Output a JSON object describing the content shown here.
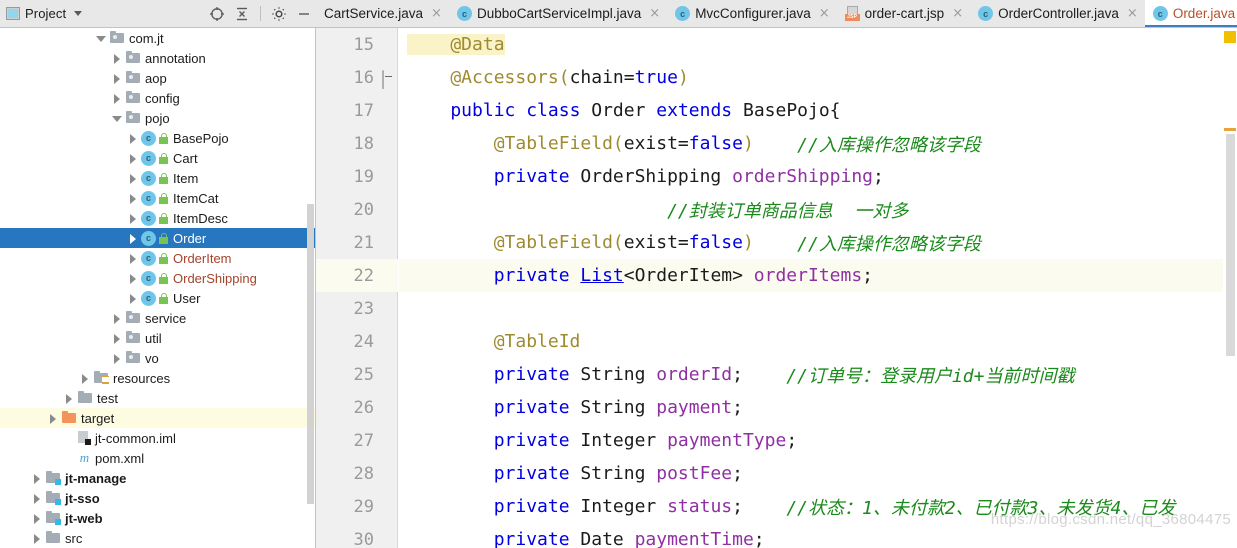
{
  "project_panel": {
    "title": "Project",
    "icon": "project-window-icon",
    "dropdown_icon": "chevron-down-icon",
    "toolbar": [
      {
        "name": "locate-target-icon",
        "label": "Select Opened File"
      },
      {
        "name": "collapse-all-icon",
        "label": "Collapse All"
      },
      {
        "name": "gear-icon",
        "label": "Settings"
      },
      {
        "name": "minimize-icon",
        "label": "Hide"
      }
    ]
  },
  "tabs": {
    "overflow_icon": "chevron-down-icon",
    "items": [
      {
        "label": "CartService.java",
        "icon": "java-class-icon",
        "active": false,
        "closable": true
      },
      {
        "label": "DubboCartServiceImpl.java",
        "icon": "java-class-icon",
        "active": false,
        "closable": true
      },
      {
        "label": "MvcConfigurer.java",
        "icon": "java-class-icon",
        "active": false,
        "closable": true
      },
      {
        "label": "order-cart.jsp",
        "icon": "jsp-file-icon",
        "active": false,
        "closable": true
      },
      {
        "label": "OrderController.java",
        "icon": "java-class-icon",
        "active": false,
        "closable": true
      },
      {
        "label": "Order.java",
        "icon": "java-class-icon",
        "active": true,
        "closable": true
      }
    ]
  },
  "tree": {
    "items": [
      {
        "label": "com.jt",
        "indent": 6,
        "arrow": "down",
        "icon": "package-folder-icon",
        "state": "normal"
      },
      {
        "label": "annotation",
        "indent": 7,
        "arrow": "right",
        "icon": "package-folder-icon",
        "state": "normal"
      },
      {
        "label": "aop",
        "indent": 7,
        "arrow": "right",
        "icon": "package-folder-icon",
        "state": "normal"
      },
      {
        "label": "config",
        "indent": 7,
        "arrow": "right",
        "icon": "package-folder-icon",
        "state": "normal"
      },
      {
        "label": "pojo",
        "indent": 7,
        "arrow": "down",
        "icon": "package-folder-icon",
        "state": "normal"
      },
      {
        "label": "BasePojo",
        "indent": 8,
        "arrow": "right",
        "icon": "java-class-icon",
        "state": "normal"
      },
      {
        "label": "Cart",
        "indent": 8,
        "arrow": "right",
        "icon": "java-class-icon",
        "state": "normal"
      },
      {
        "label": "Item",
        "indent": 8,
        "arrow": "right",
        "icon": "java-class-icon",
        "state": "normal"
      },
      {
        "label": "ItemCat",
        "indent": 8,
        "arrow": "right",
        "icon": "java-class-icon",
        "state": "normal"
      },
      {
        "label": "ItemDesc",
        "indent": 8,
        "arrow": "right",
        "icon": "java-class-icon",
        "state": "normal"
      },
      {
        "label": "Order",
        "indent": 8,
        "arrow": "right",
        "icon": "java-class-icon",
        "state": "selected"
      },
      {
        "label": "OrderItem",
        "indent": 8,
        "arrow": "right",
        "icon": "java-class-icon",
        "state": "modified"
      },
      {
        "label": "OrderShipping",
        "indent": 8,
        "arrow": "right",
        "icon": "java-class-icon",
        "state": "modified"
      },
      {
        "label": "User",
        "indent": 8,
        "arrow": "right",
        "icon": "java-class-icon",
        "state": "normal"
      },
      {
        "label": "service",
        "indent": 7,
        "arrow": "right",
        "icon": "package-folder-icon",
        "state": "normal"
      },
      {
        "label": "util",
        "indent": 7,
        "arrow": "right",
        "icon": "package-folder-icon",
        "state": "normal"
      },
      {
        "label": "vo",
        "indent": 7,
        "arrow": "right",
        "icon": "package-folder-icon",
        "state": "normal"
      },
      {
        "label": "resources",
        "indent": 5,
        "arrow": "right",
        "icon": "resources-folder-icon",
        "state": "normal"
      },
      {
        "label": "test",
        "indent": 4,
        "arrow": "right",
        "icon": "folder-icon",
        "state": "normal"
      },
      {
        "label": "target",
        "indent": 3,
        "arrow": "right",
        "icon": "excluded-folder-icon",
        "state": "highlighted"
      },
      {
        "label": "jt-common.iml",
        "indent": 4,
        "arrow": "none",
        "icon": "iml-file-icon",
        "state": "normal"
      },
      {
        "label": "pom.xml",
        "indent": 4,
        "arrow": "none",
        "icon": "maven-file-icon",
        "state": "normal"
      },
      {
        "label": "jt-manage",
        "indent": 2,
        "arrow": "right",
        "icon": "module-folder-icon",
        "state": "module"
      },
      {
        "label": "jt-sso",
        "indent": 2,
        "arrow": "right",
        "icon": "module-folder-icon",
        "state": "module"
      },
      {
        "label": "jt-web",
        "indent": 2,
        "arrow": "right",
        "icon": "module-folder-icon",
        "state": "module"
      },
      {
        "label": "src",
        "indent": 2,
        "arrow": "right",
        "icon": "folder-icon",
        "state": "normal"
      }
    ]
  },
  "editor": {
    "file": "Order.java",
    "current_line": 22,
    "lines": [
      {
        "num": "15",
        "fold": "none",
        "tokens": [
          {
            "t": "@Data",
            "c": "ann hl-data",
            "indent": 4
          }
        ]
      },
      {
        "num": "16",
        "fold": "top",
        "tokens": [
          {
            "t": "@Accessors(",
            "c": "ann",
            "indent": 4
          },
          {
            "t": "chain=",
            "c": "plain"
          },
          {
            "t": "true",
            "c": "kw"
          },
          {
            "t": ")",
            "c": "ann"
          }
        ]
      },
      {
        "num": "17",
        "fold": "none",
        "tokens": [
          {
            "t": "public ",
            "c": "kw",
            "indent": 4
          },
          {
            "t": "class ",
            "c": "kw"
          },
          {
            "t": "Order ",
            "c": "plain"
          },
          {
            "t": "extends ",
            "c": "kw"
          },
          {
            "t": "BasePojo{",
            "c": "plain"
          }
        ]
      },
      {
        "num": "18",
        "fold": "none",
        "tokens": [
          {
            "t": "@TableField(",
            "c": "ann",
            "indent": 8
          },
          {
            "t": "exist=",
            "c": "plain"
          },
          {
            "t": "false",
            "c": "kw"
          },
          {
            "t": ")",
            "c": "ann"
          },
          {
            "t": "    //入库操作忽略该字段",
            "c": "cmt"
          }
        ]
      },
      {
        "num": "19",
        "fold": "none",
        "tokens": [
          {
            "t": "private ",
            "c": "kw",
            "indent": 8
          },
          {
            "t": "OrderShipping ",
            "c": "plain"
          },
          {
            "t": "orderShipping",
            "c": "fld"
          },
          {
            "t": ";",
            "c": "plain"
          }
        ]
      },
      {
        "num": "20",
        "fold": "none",
        "tokens": [
          {
            "t": "//封装订单商品信息  一对多",
            "c": "cmt",
            "indent": 24
          }
        ]
      },
      {
        "num": "21",
        "fold": "none",
        "tokens": [
          {
            "t": "@TableField(",
            "c": "ann",
            "indent": 8
          },
          {
            "t": "exist=",
            "c": "plain"
          },
          {
            "t": "false",
            "c": "kw"
          },
          {
            "t": ")",
            "c": "ann"
          },
          {
            "t": "    //入库操作忽略该字段",
            "c": "cmt"
          }
        ]
      },
      {
        "num": "22",
        "fold": "none",
        "current": true,
        "tokens": [
          {
            "t": "private ",
            "c": "kw",
            "indent": 8
          },
          {
            "t": "List",
            "c": "lnk"
          },
          {
            "t": "<OrderItem> ",
            "c": "plain"
          },
          {
            "t": "orderItems",
            "c": "fld"
          },
          {
            "t": ";",
            "c": "plain"
          }
        ]
      },
      {
        "num": "23",
        "fold": "none",
        "tokens": []
      },
      {
        "num": "24",
        "fold": "none",
        "tokens": [
          {
            "t": "@TableId",
            "c": "ann",
            "indent": 8
          }
        ]
      },
      {
        "num": "25",
        "fold": "none",
        "tokens": [
          {
            "t": "private ",
            "c": "kw",
            "indent": 8
          },
          {
            "t": "String ",
            "c": "plain"
          },
          {
            "t": "orderId",
            "c": "fld"
          },
          {
            "t": ";",
            "c": "plain"
          },
          {
            "t": "    //订单号：登录用户id+当前时间戳",
            "c": "cmt"
          }
        ]
      },
      {
        "num": "26",
        "fold": "none",
        "tokens": [
          {
            "t": "private ",
            "c": "kw",
            "indent": 8
          },
          {
            "t": "String ",
            "c": "plain"
          },
          {
            "t": "payment",
            "c": "fld"
          },
          {
            "t": ";",
            "c": "plain"
          }
        ]
      },
      {
        "num": "27",
        "fold": "none",
        "tokens": [
          {
            "t": "private ",
            "c": "kw",
            "indent": 8
          },
          {
            "t": "Integer ",
            "c": "plain"
          },
          {
            "t": "paymentType",
            "c": "fld"
          },
          {
            "t": ";",
            "c": "plain"
          }
        ]
      },
      {
        "num": "28",
        "fold": "none",
        "tokens": [
          {
            "t": "private ",
            "c": "kw",
            "indent": 8
          },
          {
            "t": "String ",
            "c": "plain"
          },
          {
            "t": "postFee",
            "c": "fld"
          },
          {
            "t": ";",
            "c": "plain"
          }
        ]
      },
      {
        "num": "29",
        "fold": "none",
        "tokens": [
          {
            "t": "private ",
            "c": "kw",
            "indent": 8
          },
          {
            "t": "Integer ",
            "c": "plain"
          },
          {
            "t": "status",
            "c": "fld"
          },
          {
            "t": ";",
            "c": "plain"
          },
          {
            "t": "    //状态：1、未付款2、已付款3、未发货4、已发",
            "c": "cmt"
          }
        ]
      },
      {
        "num": "30",
        "fold": "none",
        "tokens": [
          {
            "t": "private ",
            "c": "kw",
            "indent": 8
          },
          {
            "t": "Date ",
            "c": "plain"
          },
          {
            "t": "paymentTime",
            "c": "fld"
          },
          {
            "t": ";",
            "c": "plain"
          }
        ]
      }
    ]
  },
  "watermark": "https://blog.csdn.net/qq_36804475",
  "colors": {
    "selection_blue": "#2677c0",
    "active_tab_text": "#b6502b",
    "keyword": "#0000e0",
    "annotation": "#9e8b2f",
    "field": "#8f2fa3",
    "comment": "#1a8a1a",
    "modified_file": "#a3442c",
    "excluded_folder": "#f3955b",
    "current_line": "#fcfbf0",
    "marker_yellow": "#f0c000"
  }
}
